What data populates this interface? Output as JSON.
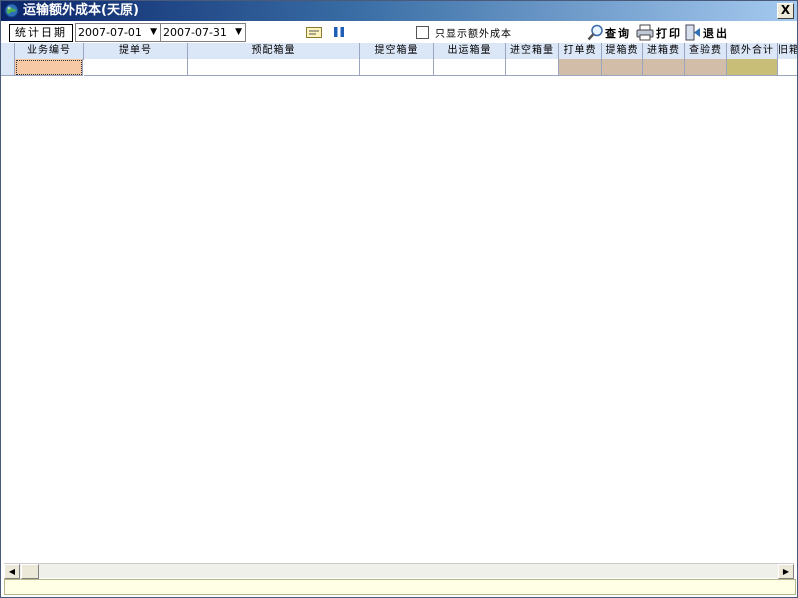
{
  "window": {
    "title": "运输额外成本(天原)",
    "close_label": "X"
  },
  "toolbar": {
    "date_label": "统计日期",
    "start_date": "2007-07-01",
    "end_date": "2007-07-31",
    "dropdown_arrow": "▼",
    "only_extra_label": "只显示额外成本",
    "query_label": "查询",
    "print_label": "打印",
    "exit_label": "退出"
  },
  "grid": {
    "columns": [
      "业务编号",
      "提单号",
      "预配箱量",
      "提空箱量",
      "出运箱量",
      "进空箱量",
      "打单费",
      "提箱费",
      "进箱费",
      "查验费",
      "额外合计",
      "旧箱"
    ],
    "colors": {
      "header_bg": "#dbe6f7",
      "selected_cell": "#f7c9a5",
      "fee_cell": "#d2bea8",
      "total_cell": "#c8be78"
    }
  },
  "scrollbar": {
    "left_arrow": "◀",
    "right_arrow": "▶"
  }
}
